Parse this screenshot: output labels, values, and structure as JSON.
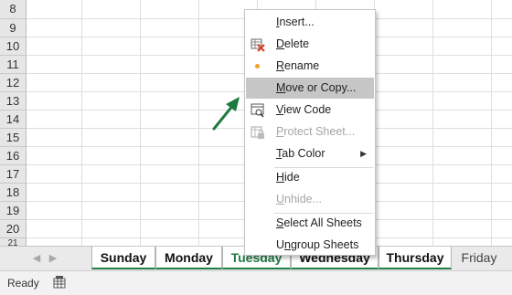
{
  "rows": [
    "8",
    "9",
    "10",
    "11",
    "12",
    "13",
    "14",
    "15",
    "16",
    "17",
    "18",
    "19",
    "20",
    "21"
  ],
  "context_menu": {
    "items": [
      {
        "label": "Insert...",
        "accel": "I",
        "enabled": true
      },
      {
        "label": "Delete",
        "accel": "D",
        "enabled": true,
        "icon": "delete-sheet-icon"
      },
      {
        "label": "Rename",
        "accel": "R",
        "enabled": true,
        "icon": "bullet-dot-icon"
      },
      {
        "label": "Move or Copy...",
        "accel": "M",
        "enabled": true,
        "highlighted": true
      },
      {
        "label": "View Code",
        "accel": "V",
        "enabled": true,
        "icon": "view-code-icon"
      },
      {
        "label": "Protect Sheet...",
        "accel": "P",
        "enabled": false,
        "icon": "protect-sheet-icon"
      },
      {
        "label": "Tab Color",
        "accel": "T",
        "enabled": true,
        "submenu": true
      },
      {
        "label": "Hide",
        "accel": "H",
        "enabled": true
      },
      {
        "label": "Unhide...",
        "accel": "U",
        "enabled": false
      },
      {
        "label": "Select All Sheets",
        "accel": "S",
        "enabled": true
      },
      {
        "label": "Ungroup Sheets",
        "accel": "n",
        "enabled": true
      }
    ]
  },
  "tabs": [
    {
      "label": "Sunday",
      "state": "grouped"
    },
    {
      "label": "Monday",
      "state": "grouped"
    },
    {
      "label": "Tuesday",
      "state": "active"
    },
    {
      "label": "Wednesday",
      "state": "grouped"
    },
    {
      "label": "Thursday",
      "state": "grouped"
    },
    {
      "label": "Friday",
      "state": "plain"
    }
  ],
  "status": {
    "text": "Ready"
  },
  "colors": {
    "accent_green": "#1f7c43",
    "arrow_green": "#1b7a3e",
    "delete_red": "#d83b2b",
    "rename_dot": "#f0a030",
    "highlight": "#c6c6c6"
  },
  "icons": {
    "tab_prev": "scroll-left-icon",
    "tab_next": "scroll-right-icon",
    "status_icon": "sheet-statistics-icon",
    "annotation": "pointer-arrow-icon"
  }
}
